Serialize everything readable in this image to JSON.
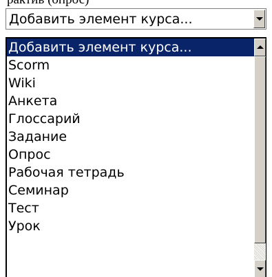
{
  "page": {
    "top_text": "рактив (опрос)"
  },
  "select": {
    "value": "Добавить элемент курса...",
    "icon": "chevron-down-icon"
  },
  "dropdown": {
    "selected_index": 0,
    "options": [
      "Добавить элемент курса...",
      "Scorm",
      "Wiki",
      "Анкета",
      "Глоссарий",
      "Задание",
      "Опрос",
      "Рабочая тетрадь",
      "Семинар",
      "Тест",
      "Урок"
    ],
    "scrollbar": {
      "up_icon": "scroll-up-icon",
      "down_icon": "scroll-down-icon"
    }
  },
  "colors": {
    "selection_background": "#0a246a",
    "selection_text": "#ffffff",
    "button_face": "#d4d0c8",
    "border": "#7f7f7f"
  }
}
